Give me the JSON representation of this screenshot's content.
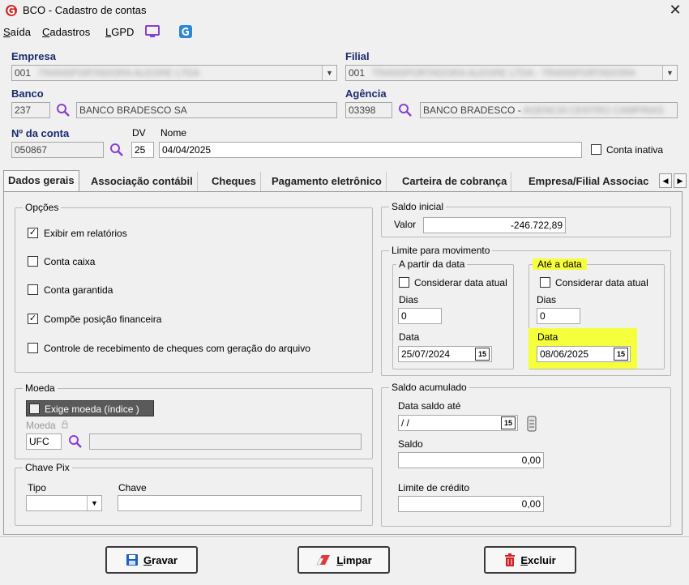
{
  "window": {
    "title": "BCO - Cadastro de contas",
    "close": "✕"
  },
  "menu": {
    "items": [
      {
        "label": "Saída",
        "underline": "S",
        "rest": "aída"
      },
      {
        "label": "Cadastros",
        "underline": "C",
        "rest": "adastros"
      },
      {
        "label": "LGPD",
        "underline": "L",
        "rest": "GPD"
      }
    ]
  },
  "empresa": {
    "label": "Empresa",
    "code": "001",
    "name": "TRANSPORTADORA ALEGRE LTDA"
  },
  "filial": {
    "label": "Filial",
    "code": "001",
    "name": "TRANSPORTADORA ALEGRE LTDA - TRANSPORTADORA"
  },
  "banco": {
    "label": "Banco",
    "code": "237",
    "name": "BANCO BRADESCO SA"
  },
  "agencia": {
    "label": "Agência",
    "code": "03398",
    "name_visible": "BANCO BRADESCO -",
    "name_hidden": "AGENCIA CENTRO CAMPINAS"
  },
  "conta": {
    "label": "Nº da conta",
    "number": "050867",
    "dv_label": "DV",
    "dv": "25",
    "nome_label": "Nome",
    "nome": "04/04/2025",
    "inativa_label": "Conta inativa",
    "inativa": false
  },
  "tabs": [
    {
      "label": "Dados gerais",
      "active": true
    },
    {
      "label": "Associação contábil",
      "active": false
    },
    {
      "label": "Cheques",
      "active": false
    },
    {
      "label": "Pagamento eletrônico",
      "active": false
    },
    {
      "label": "Carteira de cobrança",
      "active": false
    },
    {
      "label": "Empresa/Filial Associac",
      "active": false
    }
  ],
  "tab_scroll": {
    "left": "◀",
    "right": "▶"
  },
  "opcoes": {
    "title": "Opções",
    "items": [
      {
        "label": "Exibir em relatórios",
        "checked": true,
        "mark": "✓"
      },
      {
        "label": "Conta caixa",
        "checked": false,
        "mark": ""
      },
      {
        "label": "Conta garantida",
        "checked": false,
        "mark": ""
      },
      {
        "label": "Compõe posição financeira",
        "checked": true,
        "mark": "✓"
      },
      {
        "label": "Controle de recebimento de cheques com geração do arquivo",
        "checked": false,
        "mark": ""
      }
    ]
  },
  "moeda": {
    "title": "Moeda",
    "exige_label": "Exige moeda (índice )",
    "exige": false,
    "moeda_label": "Moeda",
    "moeda_code": "UFC",
    "moeda_desc": ""
  },
  "pix": {
    "title": "Chave Pix",
    "tipo_label": "Tipo",
    "tipo": "",
    "chave_label": "Chave",
    "chave": ""
  },
  "saldo_inicial": {
    "title": "Saldo inicial",
    "valor_label": "Valor",
    "valor": "-246.722,89"
  },
  "limite": {
    "title": "Limite para movimento",
    "partir": {
      "title": "A partir da data",
      "considerar_label": "Considerar data atual",
      "considerar": false,
      "dias_label": "Dias",
      "dias": "0",
      "data_label": "Data",
      "data": "25/07/2024"
    },
    "ate": {
      "title": "Até a data",
      "considerar_label": "Considerar data atual",
      "considerar": false,
      "dias_label": "Dias",
      "dias": "0",
      "data_label": "Data",
      "data": "08/06/2025"
    }
  },
  "saldo_acumulado": {
    "title": "Saldo acumulado",
    "data_label": "Data saldo até",
    "data": " / /",
    "saldo_label": "Saldo",
    "saldo": "0,00",
    "limite_label": "Limite de crédito",
    "limite": "0,00"
  },
  "calendar_glyph": "15",
  "buttons": {
    "gravar": {
      "underline": "G",
      "rest": "ravar"
    },
    "limpar": {
      "underline": "L",
      "rest": "impar"
    },
    "excluir": {
      "underline": "E",
      "rest": "xcluir"
    }
  },
  "colors": {
    "label_blue": "#1a2b6e",
    "highlight": "#f5ff3c",
    "lupa": "#8a3fd1",
    "excluir_red": "#d21f1f",
    "gravar_blue": "#1f5fbf"
  }
}
